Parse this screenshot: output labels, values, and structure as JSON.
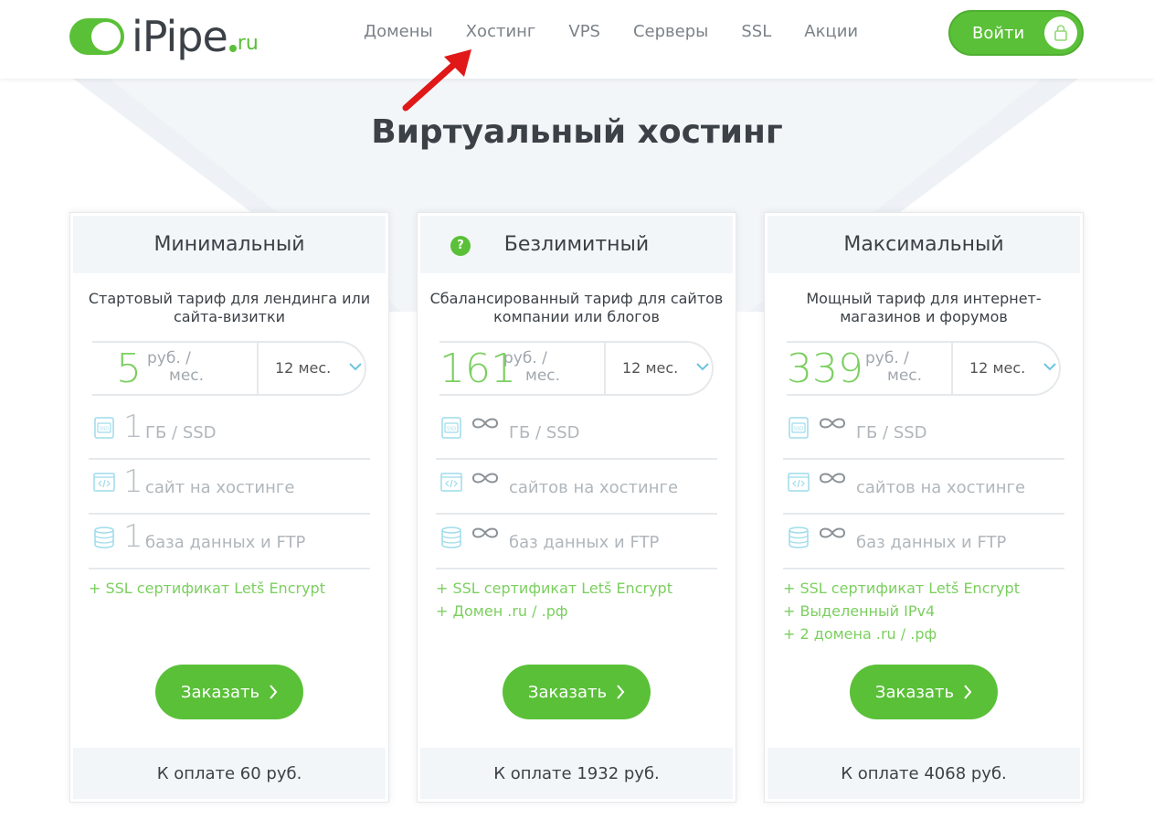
{
  "header": {
    "logo": {
      "name": "iPipe",
      "tld": "ru"
    },
    "nav": [
      "Домены",
      "Хостинг",
      "VPS",
      "Серверы",
      "SSL",
      "Акции"
    ],
    "login_label": "Войти"
  },
  "page_title": "Виртуальный хостинг",
  "colors": {
    "accent": "#5ac038",
    "light_accent": "#7bcf5f",
    "panel": "#f3f6f9"
  },
  "plans": [
    {
      "name": "Минимальный",
      "description": "Стартовый тариф для лендинга или сайта-визитки",
      "price": "5",
      "price_unit_1": "руб. /",
      "price_unit_2": "мес.",
      "period": "12 мес.",
      "features": [
        {
          "value": "1",
          "label": "ГБ / SSD",
          "icon": "ssd-icon"
        },
        {
          "value": "1",
          "label": "сайт на хостинге",
          "icon": "code-icon"
        },
        {
          "value": "1",
          "label": "база данных и FTP",
          "icon": "database-icon"
        }
      ],
      "extras": [
        "+ SSL сертификат Letš Encrypt"
      ],
      "order_label": "Заказать",
      "total": "К оплате 60 руб."
    },
    {
      "name": "Безлимитный",
      "help": "?",
      "description": "Сбалансированный тариф для сайтов компании или блогов",
      "price": "161",
      "price_unit_1": "руб. /",
      "price_unit_2": "мес.",
      "period": "12 мес.",
      "features": [
        {
          "value": "∞",
          "label": "ГБ / SSD",
          "icon": "ssd-icon"
        },
        {
          "value": "∞",
          "label": "сайтов на хостинге",
          "icon": "code-icon"
        },
        {
          "value": "∞",
          "label": "баз данных и FTP",
          "icon": "database-icon"
        }
      ],
      "extras": [
        "+ SSL сертификат Letš Encrypt",
        "+ Домен .ru / .рф"
      ],
      "order_label": "Заказать",
      "total": "К оплате 1932 руб."
    },
    {
      "name": "Максимальный",
      "description": "Мощный тариф для интернет-магазинов и форумов",
      "price": "339",
      "price_unit_1": "руб. /",
      "price_unit_2": "мес.",
      "period": "12 мес.",
      "features": [
        {
          "value": "∞",
          "label": "ГБ / SSD",
          "icon": "ssd-icon"
        },
        {
          "value": "∞",
          "label": "сайтов на хостинге",
          "icon": "code-icon"
        },
        {
          "value": "∞",
          "label": "баз данных и FTP",
          "icon": "database-icon"
        }
      ],
      "extras": [
        "+ SSL сертификат Letš Encrypt",
        "+ Выделенный IPv4",
        "+ 2 домена .ru / .рф"
      ],
      "order_label": "Заказать",
      "total": "К оплате 4068 руб."
    }
  ]
}
